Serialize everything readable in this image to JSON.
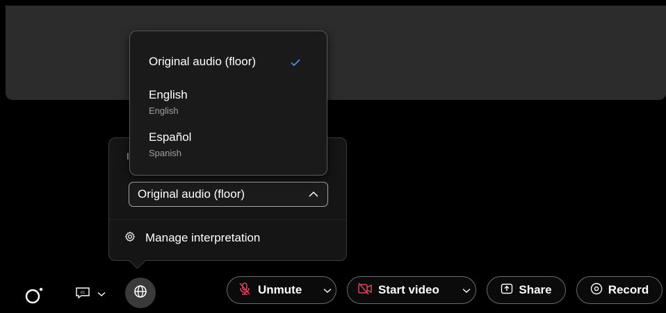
{
  "dropdown": {
    "options": [
      {
        "label": "Original audio (floor)",
        "selected": true
      },
      {
        "label": "English",
        "sublabel": "English"
      },
      {
        "label": "Español",
        "sublabel": "Spanish"
      }
    ]
  },
  "panel": {
    "label": "I",
    "selected_value": "Original audio (floor)",
    "manage_label": "Manage interpretation"
  },
  "toolbar": {
    "unmute_label": "Unmute",
    "start_video_label": "Start video",
    "share_label": "Share",
    "record_label": "Record"
  },
  "colors": {
    "accent_check": "#4a9cf0",
    "muted_red": "#e0485a",
    "active_button_bg": "#3a3a3a"
  },
  "icons": [
    "reactions-icon",
    "closed-caption-icon",
    "globe-icon",
    "mic-muted-icon",
    "video-off-icon",
    "share-icon",
    "record-icon",
    "gear-icon",
    "check-icon",
    "chevron-up-icon",
    "chevron-down-icon"
  ]
}
